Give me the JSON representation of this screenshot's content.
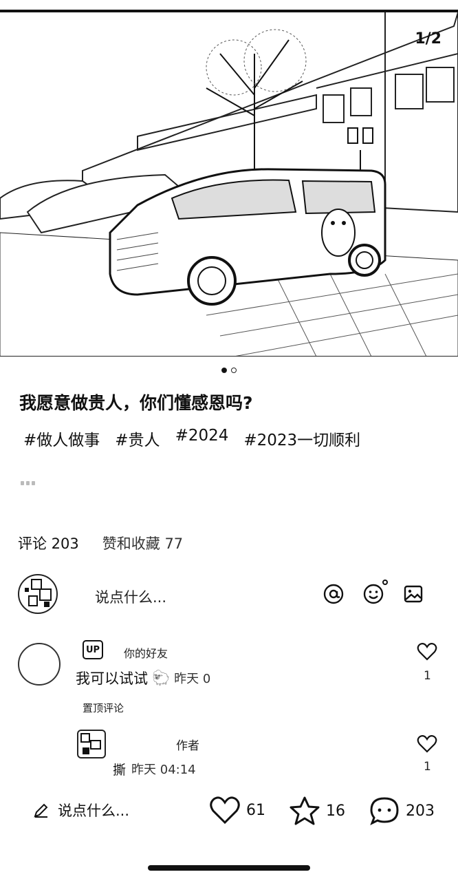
{
  "post": {
    "page_badge": "1/2",
    "title": "我愿意做贵人，你们懂感恩吗?",
    "tags": [
      "#做人做事",
      "#贵人",
      "#2024",
      "#2023一切顺利"
    ]
  },
  "stats": {
    "comments_label": "评论 203",
    "likes_saves_label": "赞和收藏 77"
  },
  "comment_input": {
    "placeholder": "说点什么..."
  },
  "comments": [
    {
      "badge": "UP",
      "relation_label": "你的好友",
      "text": "我可以试试",
      "emoji": "🐑",
      "meta": "昨天 0",
      "likes": "1",
      "pinned_label": "置顶评论"
    },
    {
      "author_tag": "作者",
      "text": "撕",
      "meta": "昨天 04:14",
      "likes": "1"
    }
  ],
  "bottom_bar": {
    "input_placeholder": "说点什么...",
    "likes": "61",
    "favorites": "16",
    "comments": "203"
  }
}
